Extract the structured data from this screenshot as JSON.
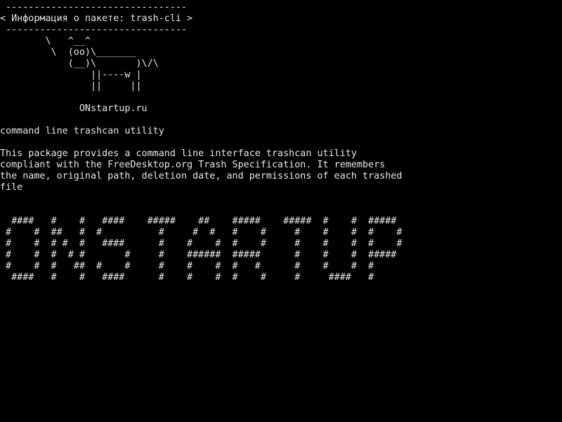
{
  "colors": {
    "background": "#000000",
    "foreground": "#e8e8e8"
  },
  "cowsay": {
    "border_top": " --------------------------------",
    "title_line": "< Информация о пакете: trash-cli >",
    "border_bottom": " --------------------------------",
    "cow_art": [
      "        \\   ^__^",
      "         \\  (oo)\\_______",
      "            (__)\\       )\\/\\",
      "                ||----w |",
      "                ||     ||"
    ],
    "site": "              ONstartup.ru"
  },
  "package": {
    "summary": "command line trashcan utility",
    "description_lines": [
      "This package provides a command line interface trashcan utility",
      "compliant with the FreeDesktop.org Trash Specification. It remembers",
      "the name, original path, deletion date, and permissions of each trashed",
      "file"
    ]
  },
  "banner_lines": [
    "  ####   #    #   ####    #####    ##    #####    #####  #    #  #####",
    " #    #  ##   #  #          #     #  #   #    #     #    #    #  #    #",
    " #    #  # #  #   ####      #    #    #  #    #     #    #    #  #    #",
    " #    #  #  # #       #     #    ######  #####      #    #    #  #####",
    " #    #  #   ##  #    #     #    #    #  #   #      #    #    #  #",
    "  ####   #    #   ####      #    #    #  #    #     #     ####   #"
  ]
}
